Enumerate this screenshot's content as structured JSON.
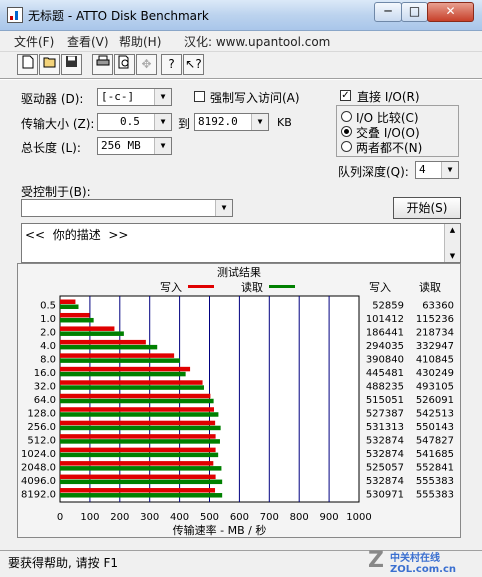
{
  "window": {
    "title": "无标题 - ATTO Disk Benchmark",
    "controls": {
      "minimize": "─",
      "maximize": "□",
      "close": "✕"
    }
  },
  "menu": {
    "file": "文件(F)",
    "view": "查看(V)",
    "help": "帮助(H)",
    "localized": "汉化: www.upantool.com"
  },
  "toolbar": {
    "icons": [
      "new-document",
      "open-folder",
      "save",
      "print",
      "print-preview",
      "move",
      "help",
      "context-help"
    ]
  },
  "form": {
    "drive_label": "驱动器 (D):",
    "drive_value": "[-c-]",
    "force_write_label": "强制写入访问(A)",
    "transfer_label": "传输大小 (Z):",
    "transfer_from": "0.5",
    "to_label": "到",
    "transfer_to": "8192.0",
    "transfer_unit": "KB",
    "total_label": "总长度 (L):",
    "total_value": "256 MB",
    "direct_io_label": "直接 I/O(R)",
    "io_compare_label": "I/O 比较(C)",
    "overlapped_io_label": "交叠 I/O(O)",
    "neither_label": "两者都不(N)",
    "queue_label": "队列深度(Q):",
    "queue_value": "4",
    "controlled_label": "受控制于(B):",
    "controlled_value": "",
    "start_label": "开始(S)",
    "description": "<<  你的描述  >>"
  },
  "status": {
    "text": "要获得帮助, 请按 F1"
  },
  "watermark": "中关村在线 ZOL.com.cn",
  "colors": {
    "write": "#e00000",
    "read": "#008000",
    "grid": "#000080"
  },
  "chart_data": {
    "type": "bar",
    "title": "测试结果",
    "orientation": "horizontal",
    "xlabel": "传输速率 - MB / 秒",
    "xlim": [
      0,
      1000
    ],
    "x_ticks": [
      "0",
      "100",
      "200",
      "300",
      "400",
      "500",
      "600",
      "700",
      "800",
      "900",
      "1000"
    ],
    "legend": {
      "write": "写入",
      "read": "读取"
    },
    "col_write": "写入",
    "col_read": "读取",
    "categories": [
      "0.5",
      "1.0",
      "2.0",
      "4.0",
      "8.0",
      "16.0",
      "32.0",
      "64.0",
      "128.0",
      "256.0",
      "512.0",
      "1024.0",
      "2048.0",
      "4096.0",
      "8192.0"
    ],
    "series": [
      {
        "name": "写入",
        "values": [
          52859,
          101412,
          186441,
          294035,
          390840,
          445481,
          488235,
          515051,
          527387,
          531313,
          532874,
          532874,
          525057,
          532874,
          530971
        ]
      },
      {
        "name": "读取",
        "values": [
          63360,
          115236,
          218734,
          332947,
          410845,
          430249,
          493105,
          526091,
          542513,
          550143,
          547827,
          541685,
          552841,
          555383,
          555383
        ]
      }
    ]
  }
}
